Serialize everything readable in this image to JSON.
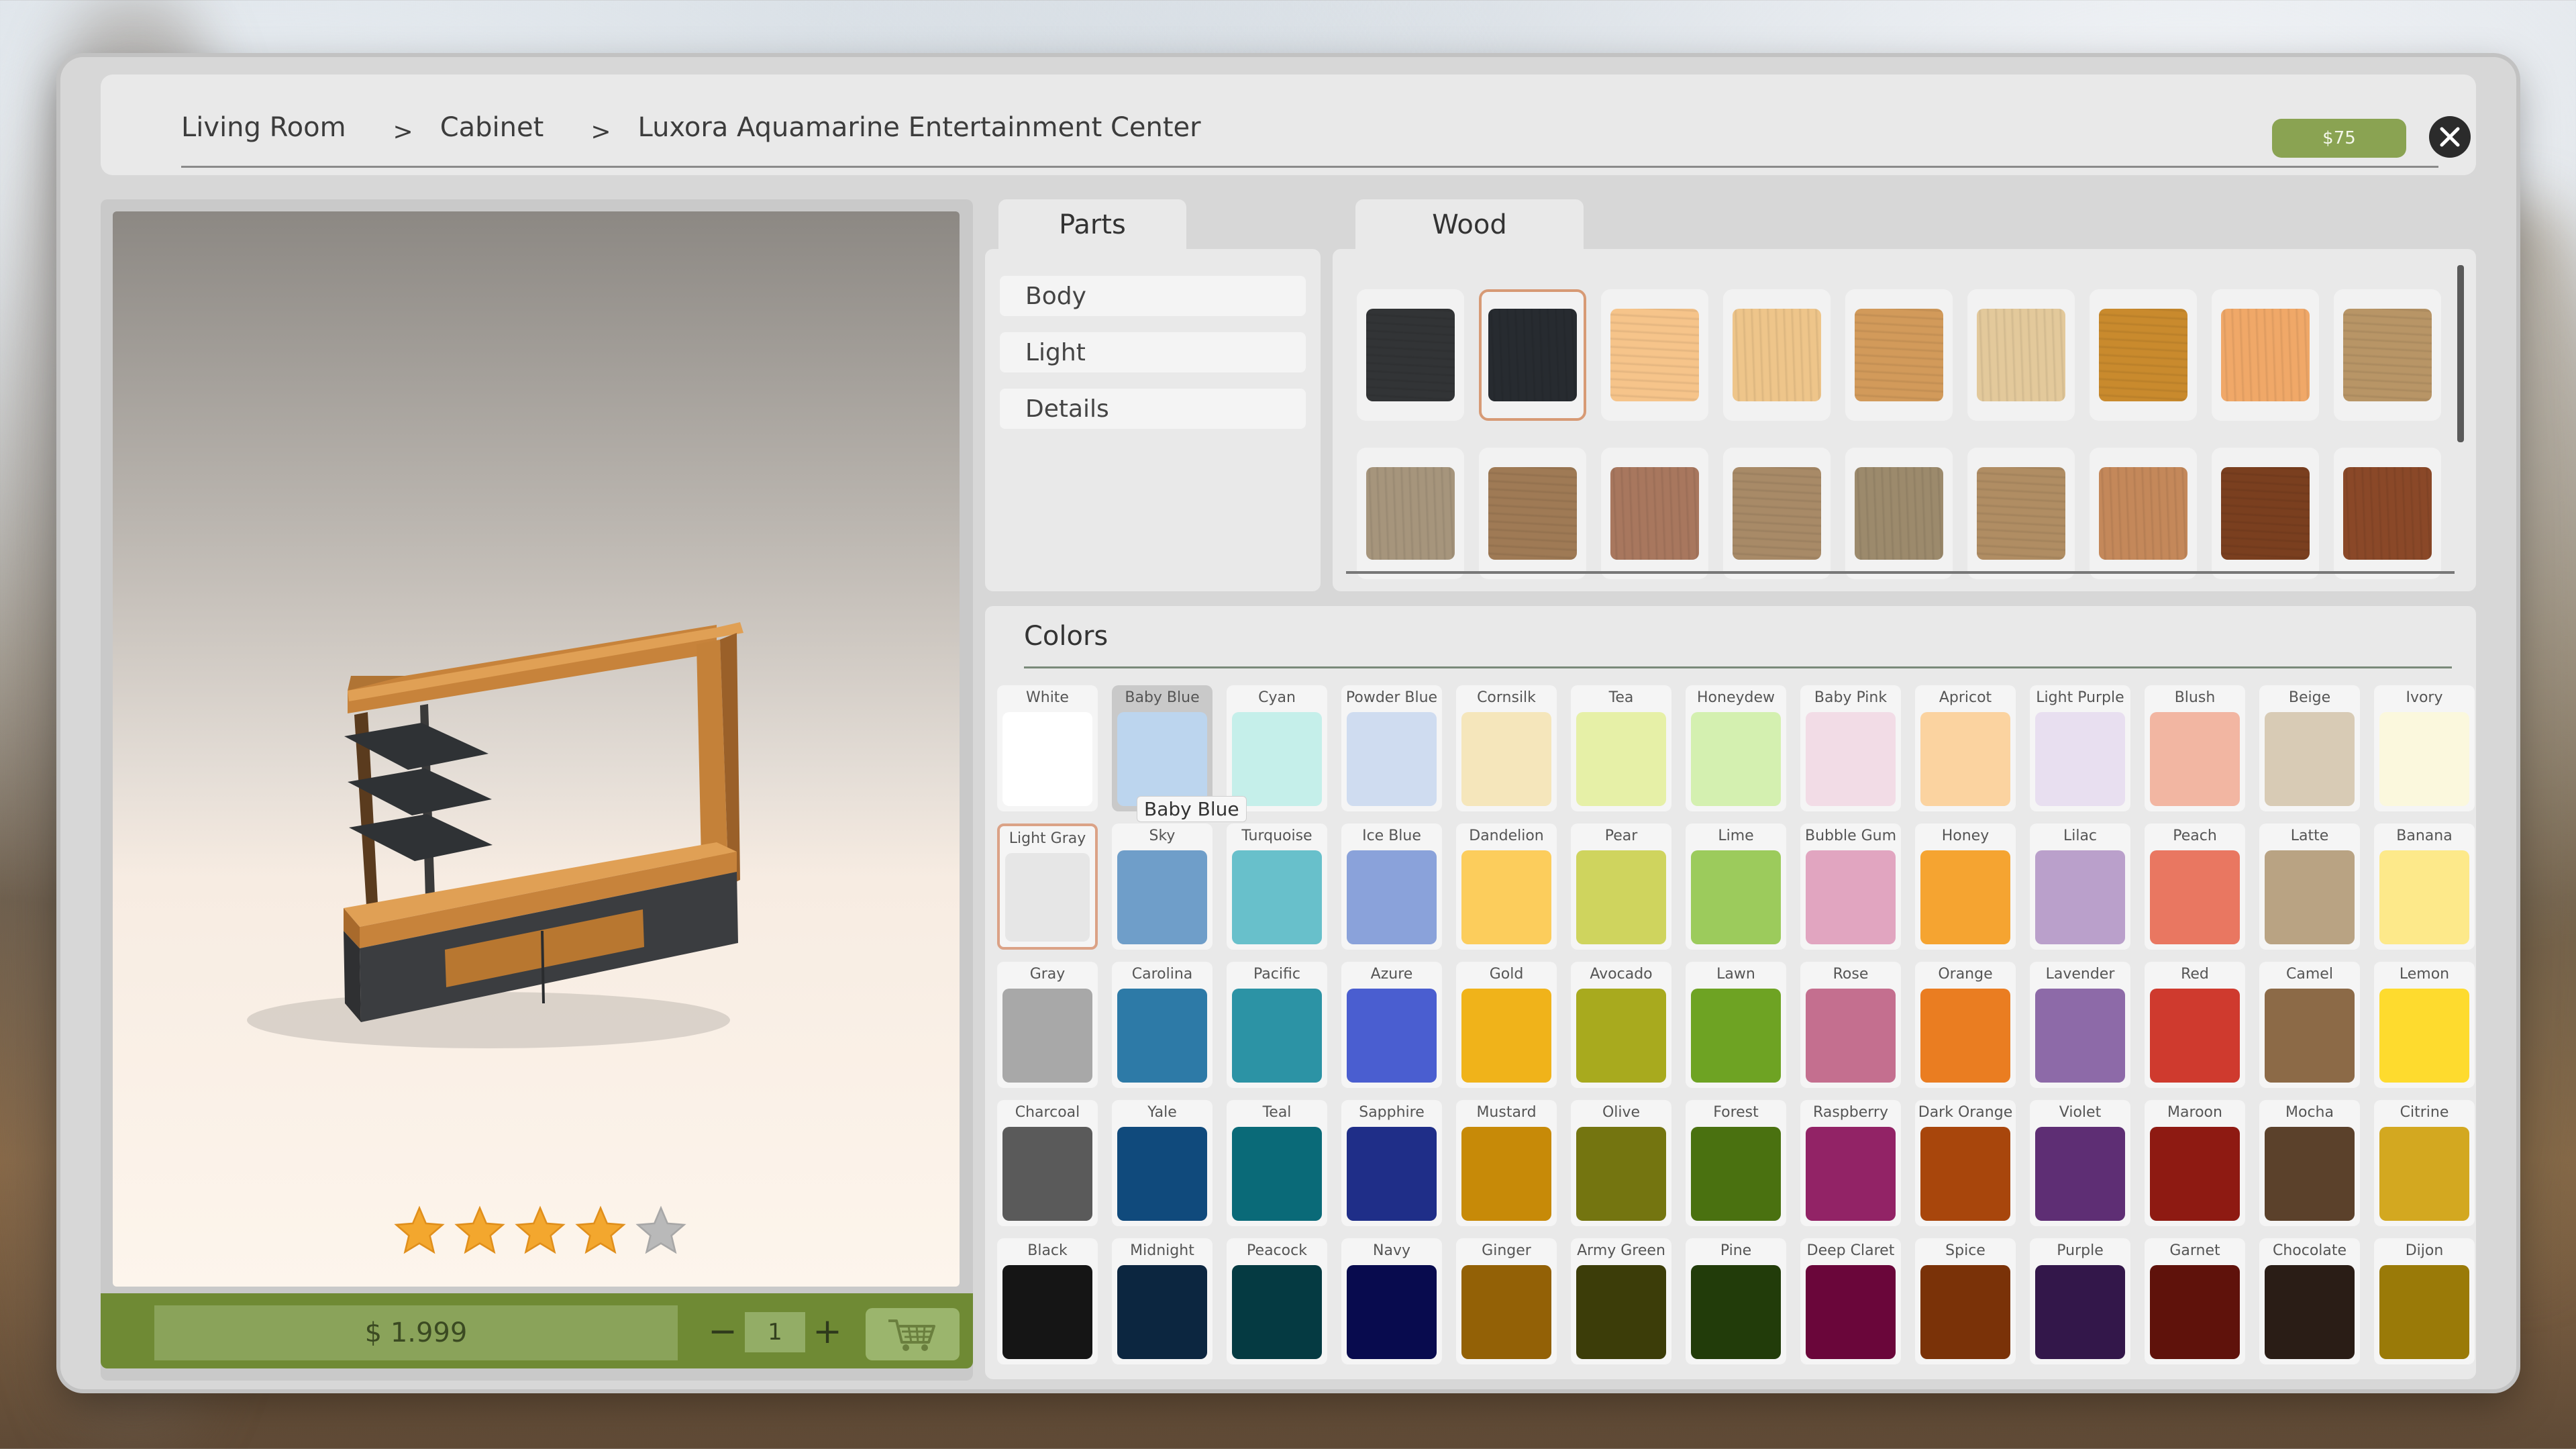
{
  "breadcrumb": [
    "Living Room",
    "Cabinet",
    "Luxora Aquamarine Entertainment Center"
  ],
  "breadcrumb_separator": ">",
  "header": {
    "money": "$75",
    "close_icon": "close-icon"
  },
  "preview": {
    "rating": 4,
    "rating_max": 5,
    "price": "$ 1.999",
    "quantity": "1",
    "minus_label": "−",
    "plus_label": "+",
    "cart_icon": "shopping-cart-icon"
  },
  "tabs": {
    "parts": "Parts",
    "material": "Wood"
  },
  "parts": [
    "Body",
    "Light",
    "Details"
  ],
  "wood_swatches": {
    "selected_index": 1,
    "items": [
      {
        "color": "#323436"
      },
      {
        "color": "#272b30"
      },
      {
        "color": "#f6c48a"
      },
      {
        "color": "#eec58a"
      },
      {
        "color": "#d29a5a"
      },
      {
        "color": "#e3c99b"
      },
      {
        "color": "#c98a2d"
      },
      {
        "color": "#f0a868"
      },
      {
        "color": "#b89566"
      },
      {
        "color": "#a6957c"
      },
      {
        "color": "#9f7a55"
      },
      {
        "color": "#a8775e"
      },
      {
        "color": "#a88a67"
      },
      {
        "color": "#9c8a6c"
      },
      {
        "color": "#b08d63"
      },
      {
        "color": "#c4885a"
      },
      {
        "color": "#7a3f1f"
      },
      {
        "color": "#8a4828"
      }
    ]
  },
  "colors": {
    "title": "Colors",
    "hovered": "Baby Blue",
    "selected": "Light Gray",
    "tooltip": "Baby Blue",
    "items": [
      {
        "name": "White",
        "hex": "#ffffff"
      },
      {
        "name": "Baby Blue",
        "hex": "#bcd5ee"
      },
      {
        "name": "Cyan",
        "hex": "#c5efea"
      },
      {
        "name": "Powder Blue",
        "hex": "#cfdcf0"
      },
      {
        "name": "Cornsilk",
        "hex": "#f5e6bb"
      },
      {
        "name": "Tea",
        "hex": "#e6f0a7"
      },
      {
        "name": "Honeydew",
        "hex": "#d4f0b0"
      },
      {
        "name": "Baby Pink",
        "hex": "#f2dce6"
      },
      {
        "name": "Apricot",
        "hex": "#fbd3a0"
      },
      {
        "name": "Light Purple",
        "hex": "#e8dff0"
      },
      {
        "name": "Blush",
        "hex": "#f2b6a2"
      },
      {
        "name": "Beige",
        "hex": "#d8cbb5"
      },
      {
        "name": "Ivory",
        "hex": "#fbf8dd"
      },
      {
        "name": "Light Gray",
        "hex": "#e6e6e6"
      },
      {
        "name": "Sky",
        "hex": "#6f9ec9"
      },
      {
        "name": "Turquoise",
        "hex": "#68c0cb"
      },
      {
        "name": "Ice Blue",
        "hex": "#8aa2da"
      },
      {
        "name": "Dandelion",
        "hex": "#fccd5c"
      },
      {
        "name": "Pear",
        "hex": "#cfd45e"
      },
      {
        "name": "Lime",
        "hex": "#9ccb5c"
      },
      {
        "name": "Bubble Gum",
        "hex": "#e1a5c0"
      },
      {
        "name": "Honey",
        "hex": "#f5a431"
      },
      {
        "name": "Lilac",
        "hex": "#baa0cb"
      },
      {
        "name": "Peach",
        "hex": "#e97761"
      },
      {
        "name": "Latte",
        "hex": "#b9a383"
      },
      {
        "name": "Banana",
        "hex": "#fde98a"
      },
      {
        "name": "Gray",
        "hex": "#a8a8a8"
      },
      {
        "name": "Carolina",
        "hex": "#2d7aa7"
      },
      {
        "name": "Pacific",
        "hex": "#2c93a5"
      },
      {
        "name": "Azure",
        "hex": "#4a5ed0"
      },
      {
        "name": "Gold",
        "hex": "#f0b31a"
      },
      {
        "name": "Avocado",
        "hex": "#a8aa1e"
      },
      {
        "name": "Lawn",
        "hex": "#6ea323"
      },
      {
        "name": "Rose",
        "hex": "#c46f8f"
      },
      {
        "name": "Orange",
        "hex": "#ea7d21"
      },
      {
        "name": "Lavender",
        "hex": "#8d6aa8"
      },
      {
        "name": "Red",
        "hex": "#cf3a2e"
      },
      {
        "name": "Camel",
        "hex": "#8c6a47"
      },
      {
        "name": "Lemon",
        "hex": "#fedb2e"
      },
      {
        "name": "Charcoal",
        "hex": "#5a5a5a"
      },
      {
        "name": "Yale",
        "hex": "#104a7c"
      },
      {
        "name": "Teal",
        "hex": "#0a6a78"
      },
      {
        "name": "Sapphire",
        "hex": "#1f2e88"
      },
      {
        "name": "Mustard",
        "hex": "#c78a08"
      },
      {
        "name": "Olive",
        "hex": "#747510"
      },
      {
        "name": "Forest",
        "hex": "#4a7110"
      },
      {
        "name": "Raspberry",
        "hex": "#922366"
      },
      {
        "name": "Dark Orange",
        "hex": "#a8460c"
      },
      {
        "name": "Violet",
        "hex": "#5e2e74"
      },
      {
        "name": "Maroon",
        "hex": "#8e1a12"
      },
      {
        "name": "Mocha",
        "hex": "#5b412b"
      },
      {
        "name": "Citrine",
        "hex": "#d3a820"
      },
      {
        "name": "Black",
        "hex": "#151515"
      },
      {
        "name": "Midnight",
        "hex": "#0c2640"
      },
      {
        "name": "Peacock",
        "hex": "#053a42"
      },
      {
        "name": "Navy",
        "hex": "#080b4e"
      },
      {
        "name": "Ginger",
        "hex": "#936106"
      },
      {
        "name": "Army Green",
        "hex": "#3c3d09"
      },
      {
        "name": "Pine",
        "hex": "#223c0a"
      },
      {
        "name": "Deep Claret",
        "hex": "#6a063a"
      },
      {
        "name": "Spice",
        "hex": "#7a3208"
      },
      {
        "name": "Purple",
        "hex": "#33174a"
      },
      {
        "name": "Garnet",
        "hex": "#5f120b"
      },
      {
        "name": "Chocolate",
        "hex": "#2a1d16"
      },
      {
        "name": "Dijon",
        "hex": "#9a7a08"
      }
    ]
  }
}
